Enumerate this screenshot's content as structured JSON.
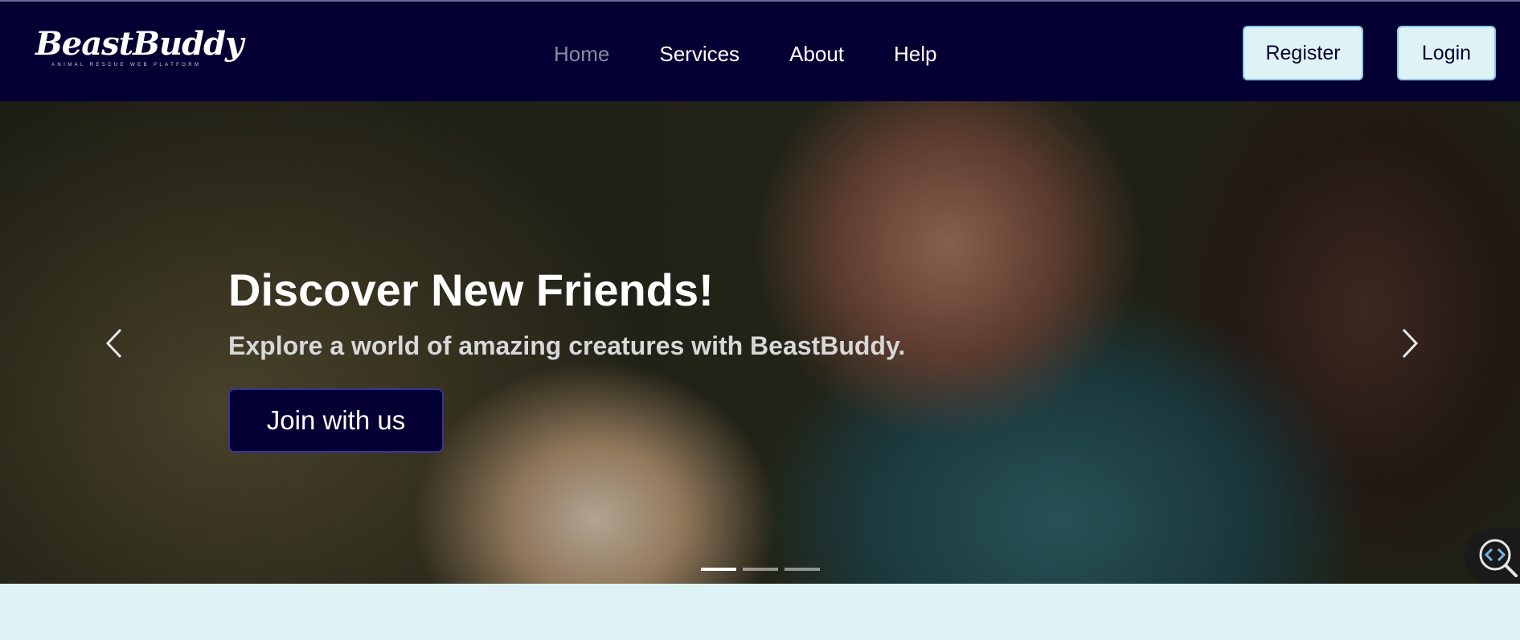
{
  "brand": {
    "name": "BeastBuddy",
    "tagline": "ANIMAL RESCUE WEB PLATFORM"
  },
  "nav": {
    "items": [
      {
        "label": "Home",
        "active": true
      },
      {
        "label": "Services",
        "active": false
      },
      {
        "label": "About",
        "active": false
      },
      {
        "label": "Help",
        "active": false
      }
    ],
    "register_label": "Register",
    "login_label": "Login"
  },
  "hero": {
    "title": "Discover New Friends!",
    "subtitle": "Explore a world of amazing creatures with BeastBuddy.",
    "cta_label": "Join with us",
    "prev_icon": "chevron-left-icon",
    "next_icon": "chevron-right-icon",
    "slide_count": 3,
    "active_slide": 1
  },
  "colors": {
    "navbar_bg": "#050033",
    "button_light_bg": "#dff3f7",
    "cta_bg": "#050033",
    "page_bg": "#dff3f7"
  },
  "widgets": {
    "zoom_icon": "code-search-icon"
  }
}
